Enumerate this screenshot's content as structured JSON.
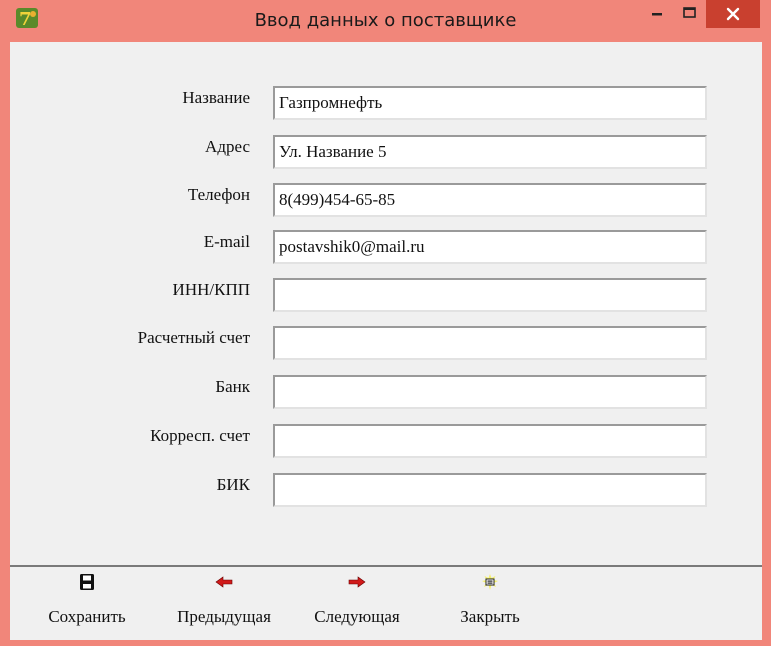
{
  "window": {
    "title": "Ввод данных о поставщике",
    "colors": {
      "frame": "#f1867a",
      "close": "#c9402f",
      "client": "#f0f0f0"
    }
  },
  "form": {
    "fields": [
      {
        "label": "Название",
        "value": "Газпромнефть",
        "placeholder": ""
      },
      {
        "label": "Адрес",
        "value": "Ул. Название 5",
        "placeholder": ""
      },
      {
        "label": "Телефон",
        "value": "8(499)454-65-85",
        "placeholder": ""
      },
      {
        "label": "E-mail",
        "value": "postavshik0@mail.ru",
        "placeholder": ""
      },
      {
        "label": "ИНН/КПП",
        "value": "",
        "placeholder": ""
      },
      {
        "label": "Расчетный счет",
        "value": "",
        "placeholder": ""
      },
      {
        "label": "Банк",
        "value": "",
        "placeholder": ""
      },
      {
        "label": "Корресп. счет",
        "value": "",
        "placeholder": ""
      },
      {
        "label": "БИК",
        "value": "",
        "placeholder": ""
      }
    ]
  },
  "toolbar": {
    "save": {
      "label": "Сохранить",
      "icon": "floppy-disk-icon"
    },
    "prev": {
      "label": "Предыдущая",
      "icon": "arrow-left-icon"
    },
    "next": {
      "label": "Следующая",
      "icon": "arrow-right-icon"
    },
    "close": {
      "label": "Закрыть",
      "icon": "door-exit-icon"
    }
  }
}
